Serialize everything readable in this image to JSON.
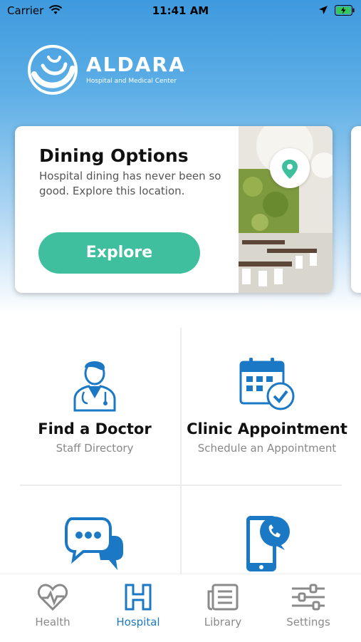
{
  "status_bar": {
    "carrier": "Carrier",
    "time": "11:41 AM"
  },
  "brand": {
    "name": "ALDARA",
    "subtitle": "Hospital and Medical Center"
  },
  "feature_card": {
    "title": "Dining Options",
    "description": "Hospital dining has never been so good. Explore this location.",
    "button_label": "Explore",
    "accent_color": "#3fbf9d"
  },
  "tiles": [
    {
      "title": "Find a Doctor",
      "subtitle": "Staff Directory",
      "icon": "doctor-icon"
    },
    {
      "title": "Clinic Appointment",
      "subtitle": "Schedule an Appointment",
      "icon": "calendar-check-icon"
    },
    {
      "title": "",
      "subtitle": "",
      "icon": "chat-bubbles-icon"
    },
    {
      "title": "",
      "subtitle": "",
      "icon": "phone-call-icon"
    }
  ],
  "tabs": [
    {
      "label": "Health",
      "icon": "heart-pulse-icon",
      "active": false
    },
    {
      "label": "Hospital",
      "icon": "hospital-h-icon",
      "active": true
    },
    {
      "label": "Library",
      "icon": "library-icon",
      "active": false
    },
    {
      "label": "Settings",
      "icon": "sliders-icon",
      "active": false
    }
  ],
  "colors": {
    "primary_blue": "#1b78c4",
    "tab_inactive": "#8a8a8a",
    "accent_green": "#3fbf9d"
  }
}
